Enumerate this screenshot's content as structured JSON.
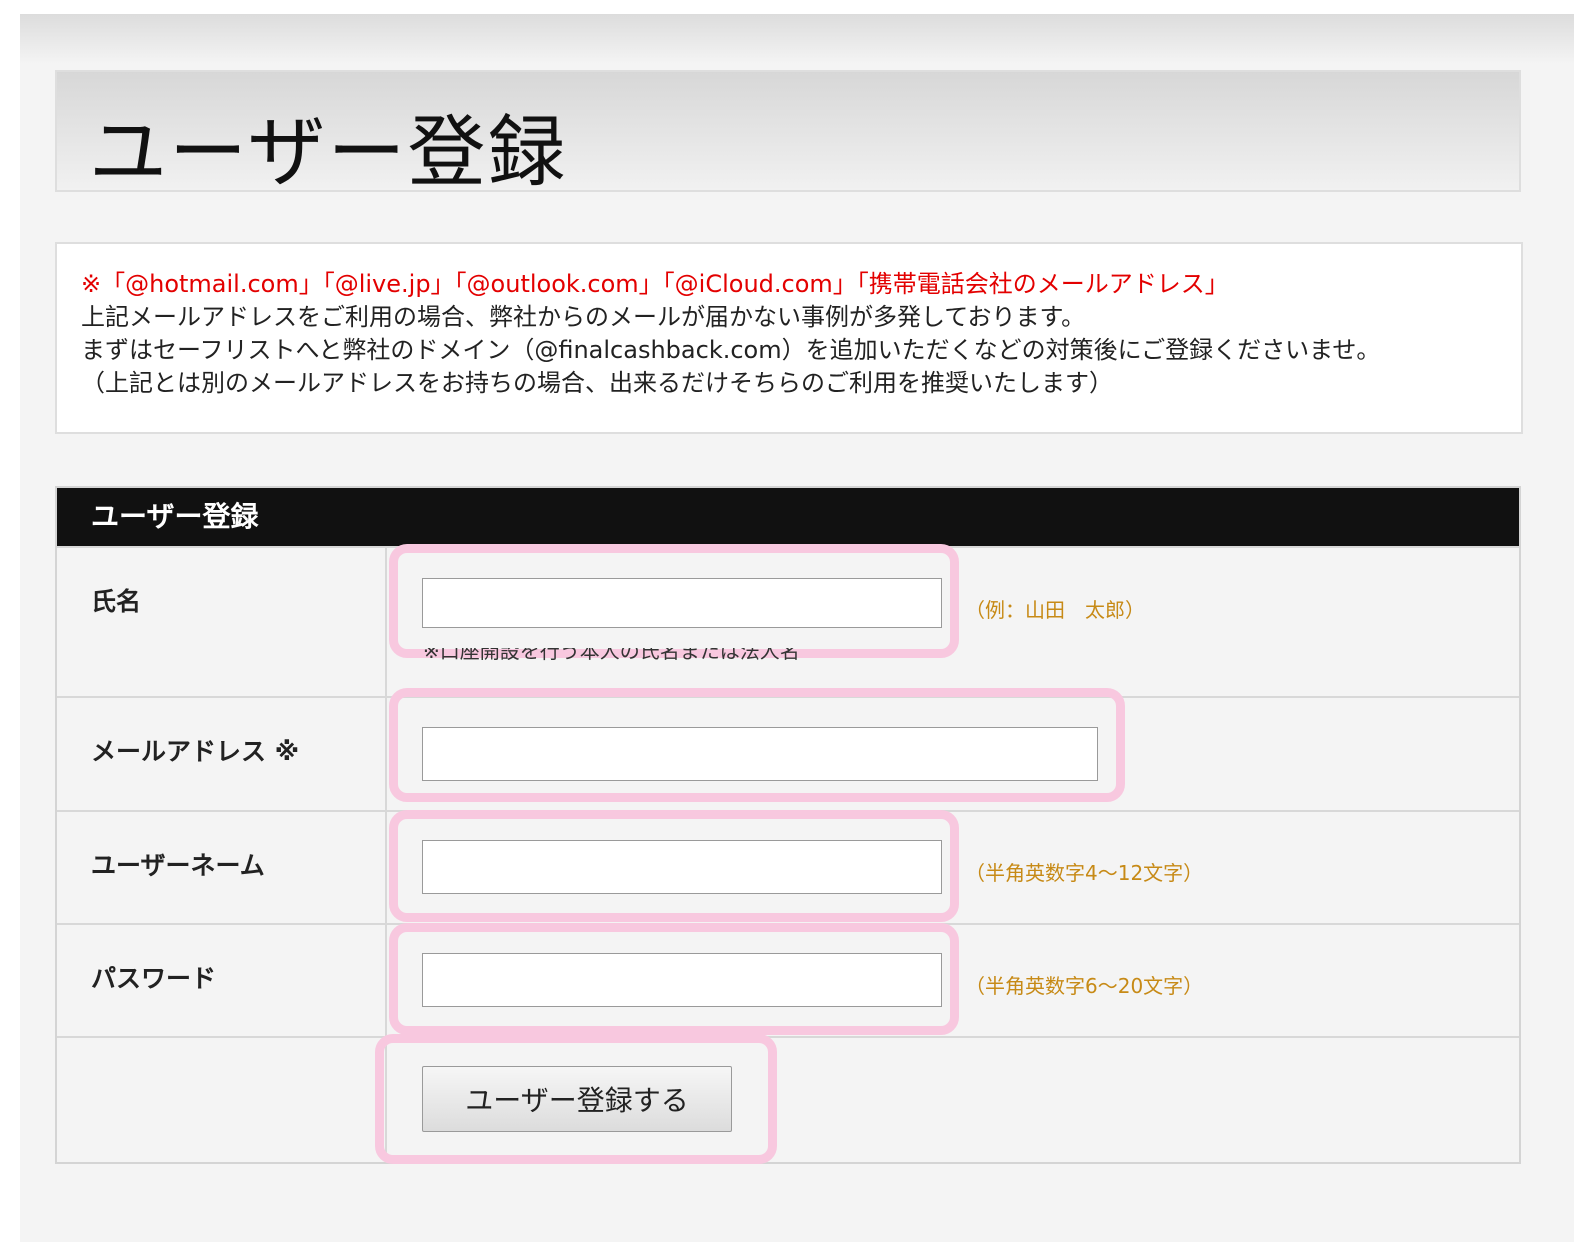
{
  "page_title": "ユーザー登録",
  "notice": {
    "line1": "※「@hotmail.com」「@live.jp」「@outlook.com」「@iCloud.com」「携帯電話会社のメールアドレス」",
    "line2": "上記メールアドレスをご利用の場合、弊社からのメールが届かない事例が多発しております。",
    "line3": "まずはセーフリストへと弊社のドメイン（@finalcashback.com）を追加いただくなどの対策後にご登録くださいませ。",
    "line4": "（上記とは別のメールアドレスをお持ちの場合、出来るだけそちらのご利用を推奨いたします）"
  },
  "form": {
    "header": "ユーザー登録",
    "name": {
      "label": "氏名",
      "value": "",
      "hint": "（例：山田　太郎）",
      "note": "※口座開設を行う本人の氏名または法人名"
    },
    "email": {
      "label": "メールアドレス ※",
      "value": ""
    },
    "username": {
      "label": "ユーザーネーム",
      "value": "",
      "hint": "（半角英数字4～12文字）"
    },
    "password": {
      "label": "パスワード",
      "value": "",
      "hint": "（半角英数字6～20文字）"
    },
    "submit_label": "ユーザー登録する"
  },
  "colors": {
    "highlight": "#f8c8df",
    "notice_red": "#e30000",
    "hint": "#c78a16",
    "header_bg": "#111111"
  }
}
